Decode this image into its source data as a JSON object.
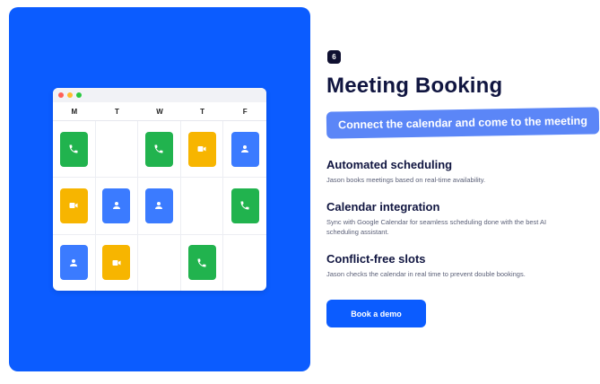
{
  "colors": {
    "hero_bg": "#0b5cff",
    "green": "#21b34e",
    "yellow": "#f7b500",
    "blue": "#3b7bff",
    "dot_red": "#ff5f57",
    "dot_yellow": "#febc2e",
    "dot_green": "#28c840"
  },
  "calendar": {
    "days": [
      "M",
      "T",
      "W",
      "T",
      "F"
    ],
    "rows": [
      [
        "phone-icon",
        null,
        "phone-icon",
        "video-icon",
        "person-icon"
      ],
      [
        "video-icon",
        "person-icon",
        "person-icon",
        null,
        "phone-icon"
      ],
      [
        "person-icon",
        "video-icon",
        null,
        "phone-icon",
        null
      ]
    ]
  },
  "section": {
    "step": "6",
    "title": "Meeting Booking",
    "tagline": "Connect the calendar and come to the meeting",
    "features": [
      {
        "title": "Automated scheduling",
        "desc": "Jason books meetings based on real-time availability."
      },
      {
        "title": "Calendar integration",
        "desc": "Sync with Google Calendar for seamless scheduling done with the best AI scheduling assistant."
      },
      {
        "title": "Conflict-free slots",
        "desc": "Jason checks the calendar in real time to prevent double bookings."
      }
    ],
    "cta": "Book a demo"
  }
}
